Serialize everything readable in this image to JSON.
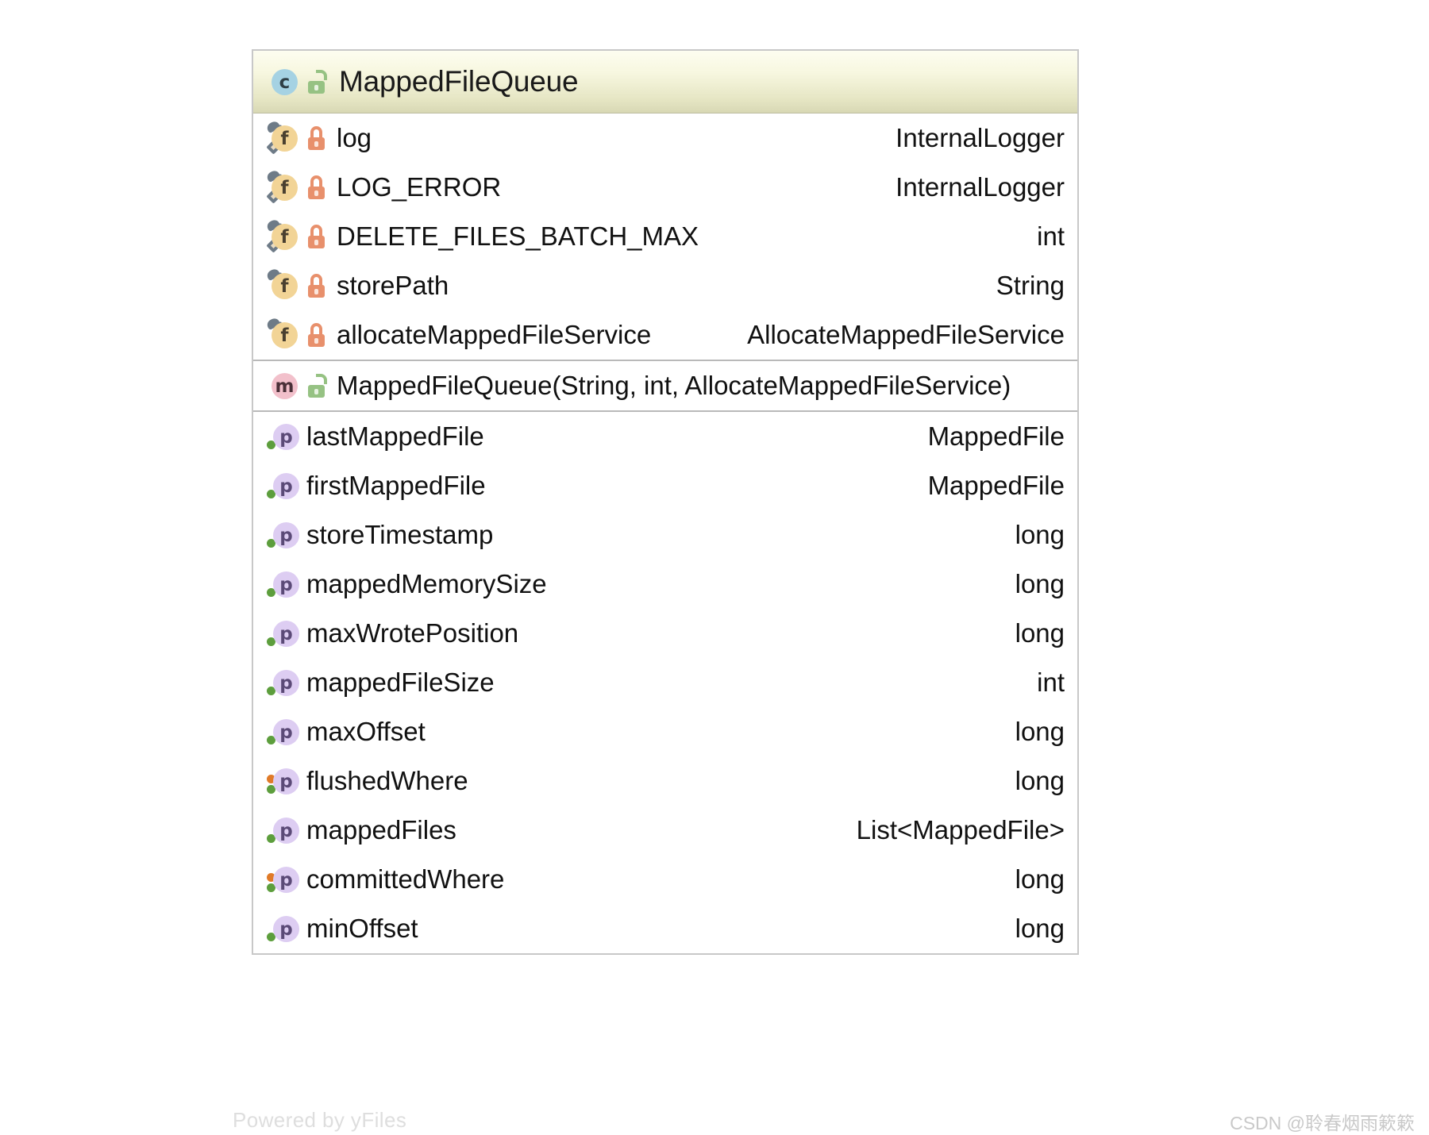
{
  "diagram": {
    "kind": "uml-class-diagram",
    "class": {
      "name": "MappedFileQueue",
      "icon": "class-icon",
      "icon_letter": "c",
      "visibility": "public",
      "visibility_icon": "open-lock-icon"
    },
    "sections": [
      {
        "id": "fields",
        "rows": [
          {
            "icon": "field-icon",
            "icon_letter": "f",
            "static_final": true,
            "visibility": "private",
            "visibility_icon": "closed-lock-icon",
            "name": "log",
            "type": "InternalLogger"
          },
          {
            "icon": "field-icon",
            "icon_letter": "f",
            "static_final": true,
            "visibility": "private",
            "visibility_icon": "closed-lock-icon",
            "name": "LOG_ERROR",
            "type": "InternalLogger"
          },
          {
            "icon": "field-icon",
            "icon_letter": "f",
            "static_final": true,
            "visibility": "private",
            "visibility_icon": "closed-lock-icon",
            "name": "DELETE_FILES_BATCH_MAX",
            "type": "int"
          },
          {
            "icon": "field-icon",
            "icon_letter": "f",
            "static_final": false,
            "visibility": "private",
            "visibility_icon": "closed-lock-icon",
            "name": "storePath",
            "type": "String"
          },
          {
            "icon": "field-icon",
            "icon_letter": "f",
            "static_final": false,
            "visibility": "private",
            "visibility_icon": "closed-lock-icon",
            "name": "allocateMappedFileService",
            "type": "AllocateMappedFileService"
          }
        ]
      },
      {
        "id": "constructors",
        "rows": [
          {
            "icon": "method-icon",
            "icon_letter": "m",
            "visibility": "public",
            "visibility_icon": "open-lock-icon",
            "name": "MappedFileQueue(String, int, AllocateMappedFileService)",
            "type": ""
          }
        ]
      },
      {
        "id": "properties",
        "rows": [
          {
            "icon": "property-icon",
            "icon_letter": "p",
            "read": true,
            "write": false,
            "name": "lastMappedFile",
            "type": "MappedFile"
          },
          {
            "icon": "property-icon",
            "icon_letter": "p",
            "read": true,
            "write": false,
            "name": "firstMappedFile",
            "type": "MappedFile"
          },
          {
            "icon": "property-icon",
            "icon_letter": "p",
            "read": true,
            "write": false,
            "name": "storeTimestamp",
            "type": "long"
          },
          {
            "icon": "property-icon",
            "icon_letter": "p",
            "read": true,
            "write": false,
            "name": "mappedMemorySize",
            "type": "long"
          },
          {
            "icon": "property-icon",
            "icon_letter": "p",
            "read": true,
            "write": false,
            "name": "maxWrotePosition",
            "type": "long"
          },
          {
            "icon": "property-icon",
            "icon_letter": "p",
            "read": true,
            "write": false,
            "name": "mappedFileSize",
            "type": "int"
          },
          {
            "icon": "property-icon",
            "icon_letter": "p",
            "read": true,
            "write": false,
            "name": "maxOffset",
            "type": "long"
          },
          {
            "icon": "property-icon",
            "icon_letter": "p",
            "read": true,
            "write": true,
            "name": "flushedWhere",
            "type": "long"
          },
          {
            "icon": "property-icon",
            "icon_letter": "p",
            "read": true,
            "write": false,
            "name": "mappedFiles",
            "type": "List<MappedFile>"
          },
          {
            "icon": "property-icon",
            "icon_letter": "p",
            "read": true,
            "write": true,
            "name": "committedWhere",
            "type": "long"
          },
          {
            "icon": "property-icon",
            "icon_letter": "p",
            "read": true,
            "write": false,
            "name": "minOffset",
            "type": "long"
          }
        ]
      }
    ]
  },
  "watermarks": {
    "yfiles": "Powered by yFiles",
    "csdn": "CSDN @聆春烟雨簌簌"
  },
  "colors": {
    "header_gradient_top": "#fdfdf0",
    "header_gradient_bottom": "#d8d8b4",
    "card_border": "#c8c8c8",
    "class_icon": "#a5d2e3",
    "field_icon": "#f2d496",
    "method_icon": "#f2c0cb",
    "property_icon": "#ddcdf2",
    "lock_private": "#e8906c",
    "lock_public": "#96c283",
    "dot_read": "#5d9e3d",
    "dot_write": "#e07a28"
  }
}
